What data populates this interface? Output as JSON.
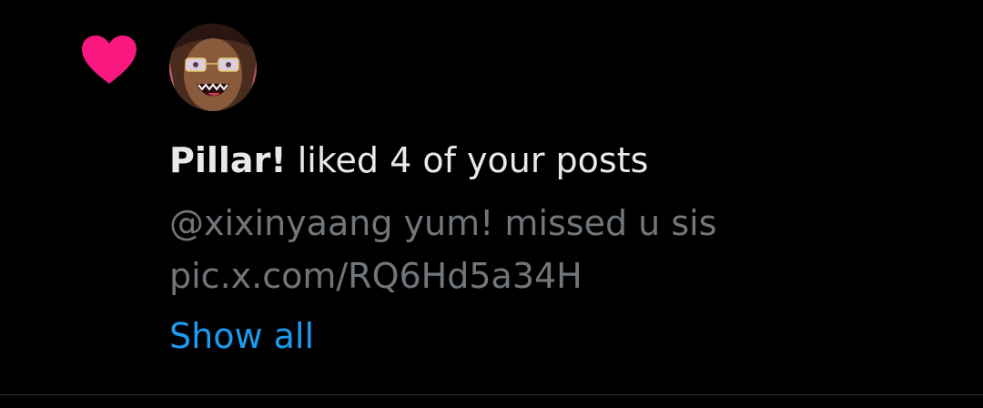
{
  "notification": {
    "icon": "heart-icon",
    "icon_color": "#f91880",
    "avatar": "user-avatar",
    "user_name": "Pillar!",
    "action_text": " liked 4 of your posts",
    "post_text": "@xixinyaang yum! missed u sis pic.x.com/RQ6Hd5a34H",
    "show_all_label": "Show all"
  },
  "colors": {
    "background": "#000000",
    "primary_text": "#e7e9ea",
    "secondary_text": "#71767b",
    "link": "#1d9bf0",
    "divider": "#2f3336"
  }
}
